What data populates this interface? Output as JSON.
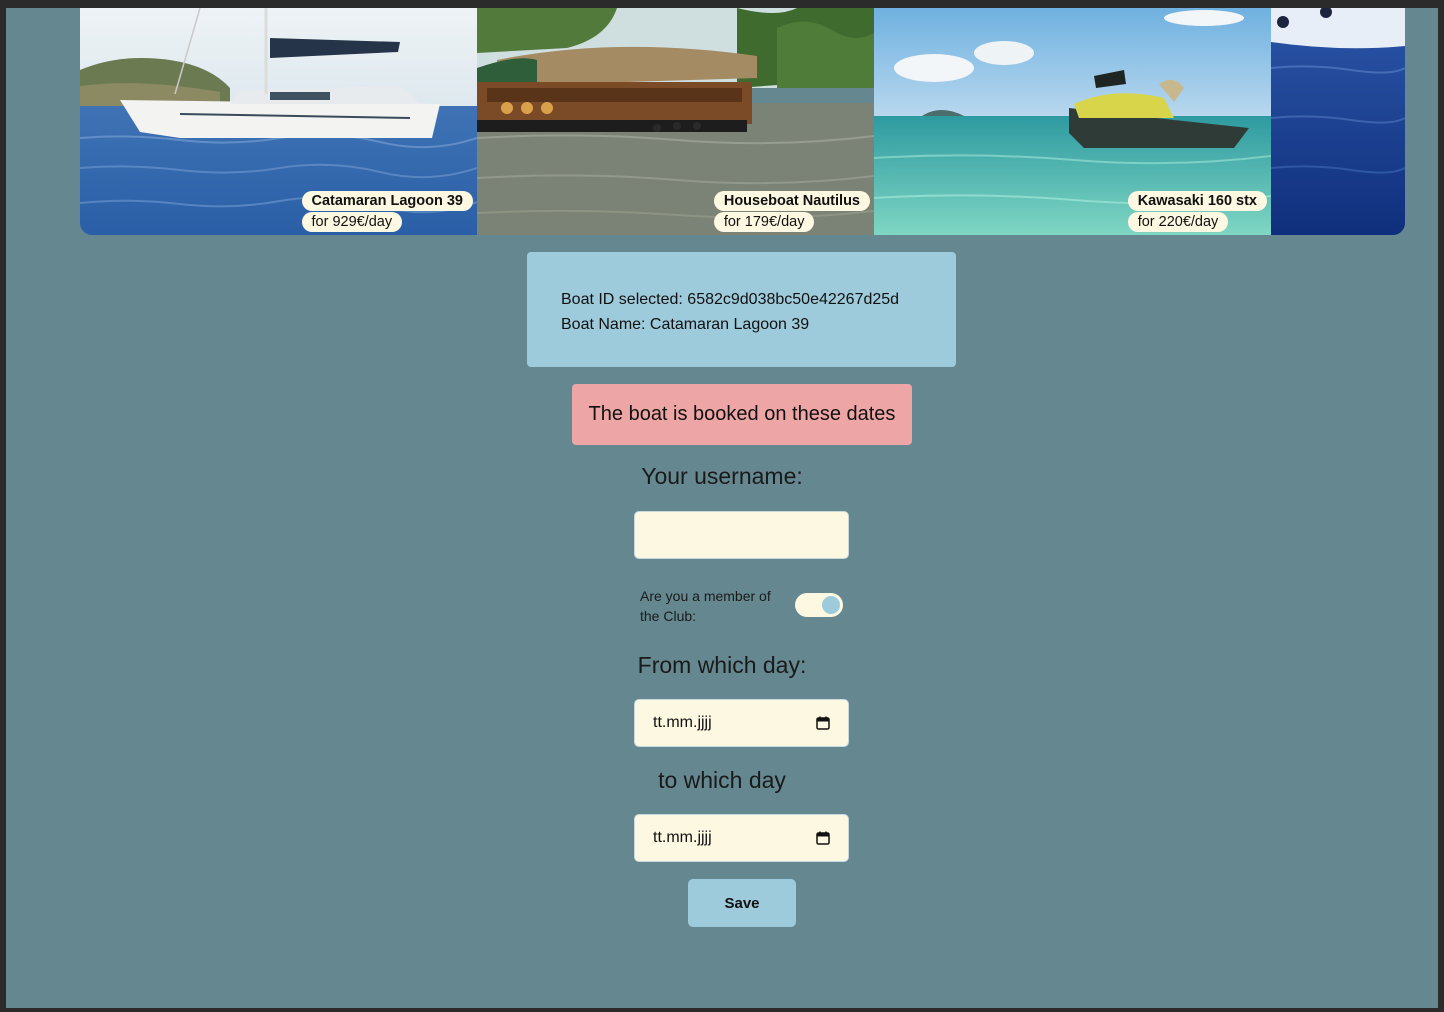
{
  "carousel": {
    "slides": [
      {
        "name": "Catamaran Lagoon 39",
        "price": "for 929€/day",
        "image": "catamaran-photo"
      },
      {
        "name": "Houseboat Nautilus",
        "price": "for 179€/day",
        "image": "houseboat-photo"
      },
      {
        "name": "Kawasaki 160 stx",
        "price": "for 220€/day",
        "image": "jetski-photo"
      },
      {
        "image": "speedboat-photo"
      }
    ]
  },
  "selection": {
    "id_line": "Boat ID selected: 6582c9d038bc50e42267d25d",
    "name_line": "Boat Name: Catamaran Lagoon 39"
  },
  "alert": {
    "message": "The boat is booked on these dates"
  },
  "form": {
    "username_label": "Your username:",
    "username_value": "",
    "member_label": "Are you a member of the Club:",
    "member_toggle_on": true,
    "from_label": "From which day:",
    "from_placeholder": "tt.mm.jjjj",
    "to_label": "to which day",
    "to_placeholder": "tt.mm.jjjj",
    "save_label": "Save"
  },
  "colors": {
    "page_bg": "#658790",
    "info_box": "#9ecbdb",
    "alert_bg": "#eda6a5",
    "input_bg": "#fdf8e1",
    "button_bg": "#9ecbdb"
  }
}
